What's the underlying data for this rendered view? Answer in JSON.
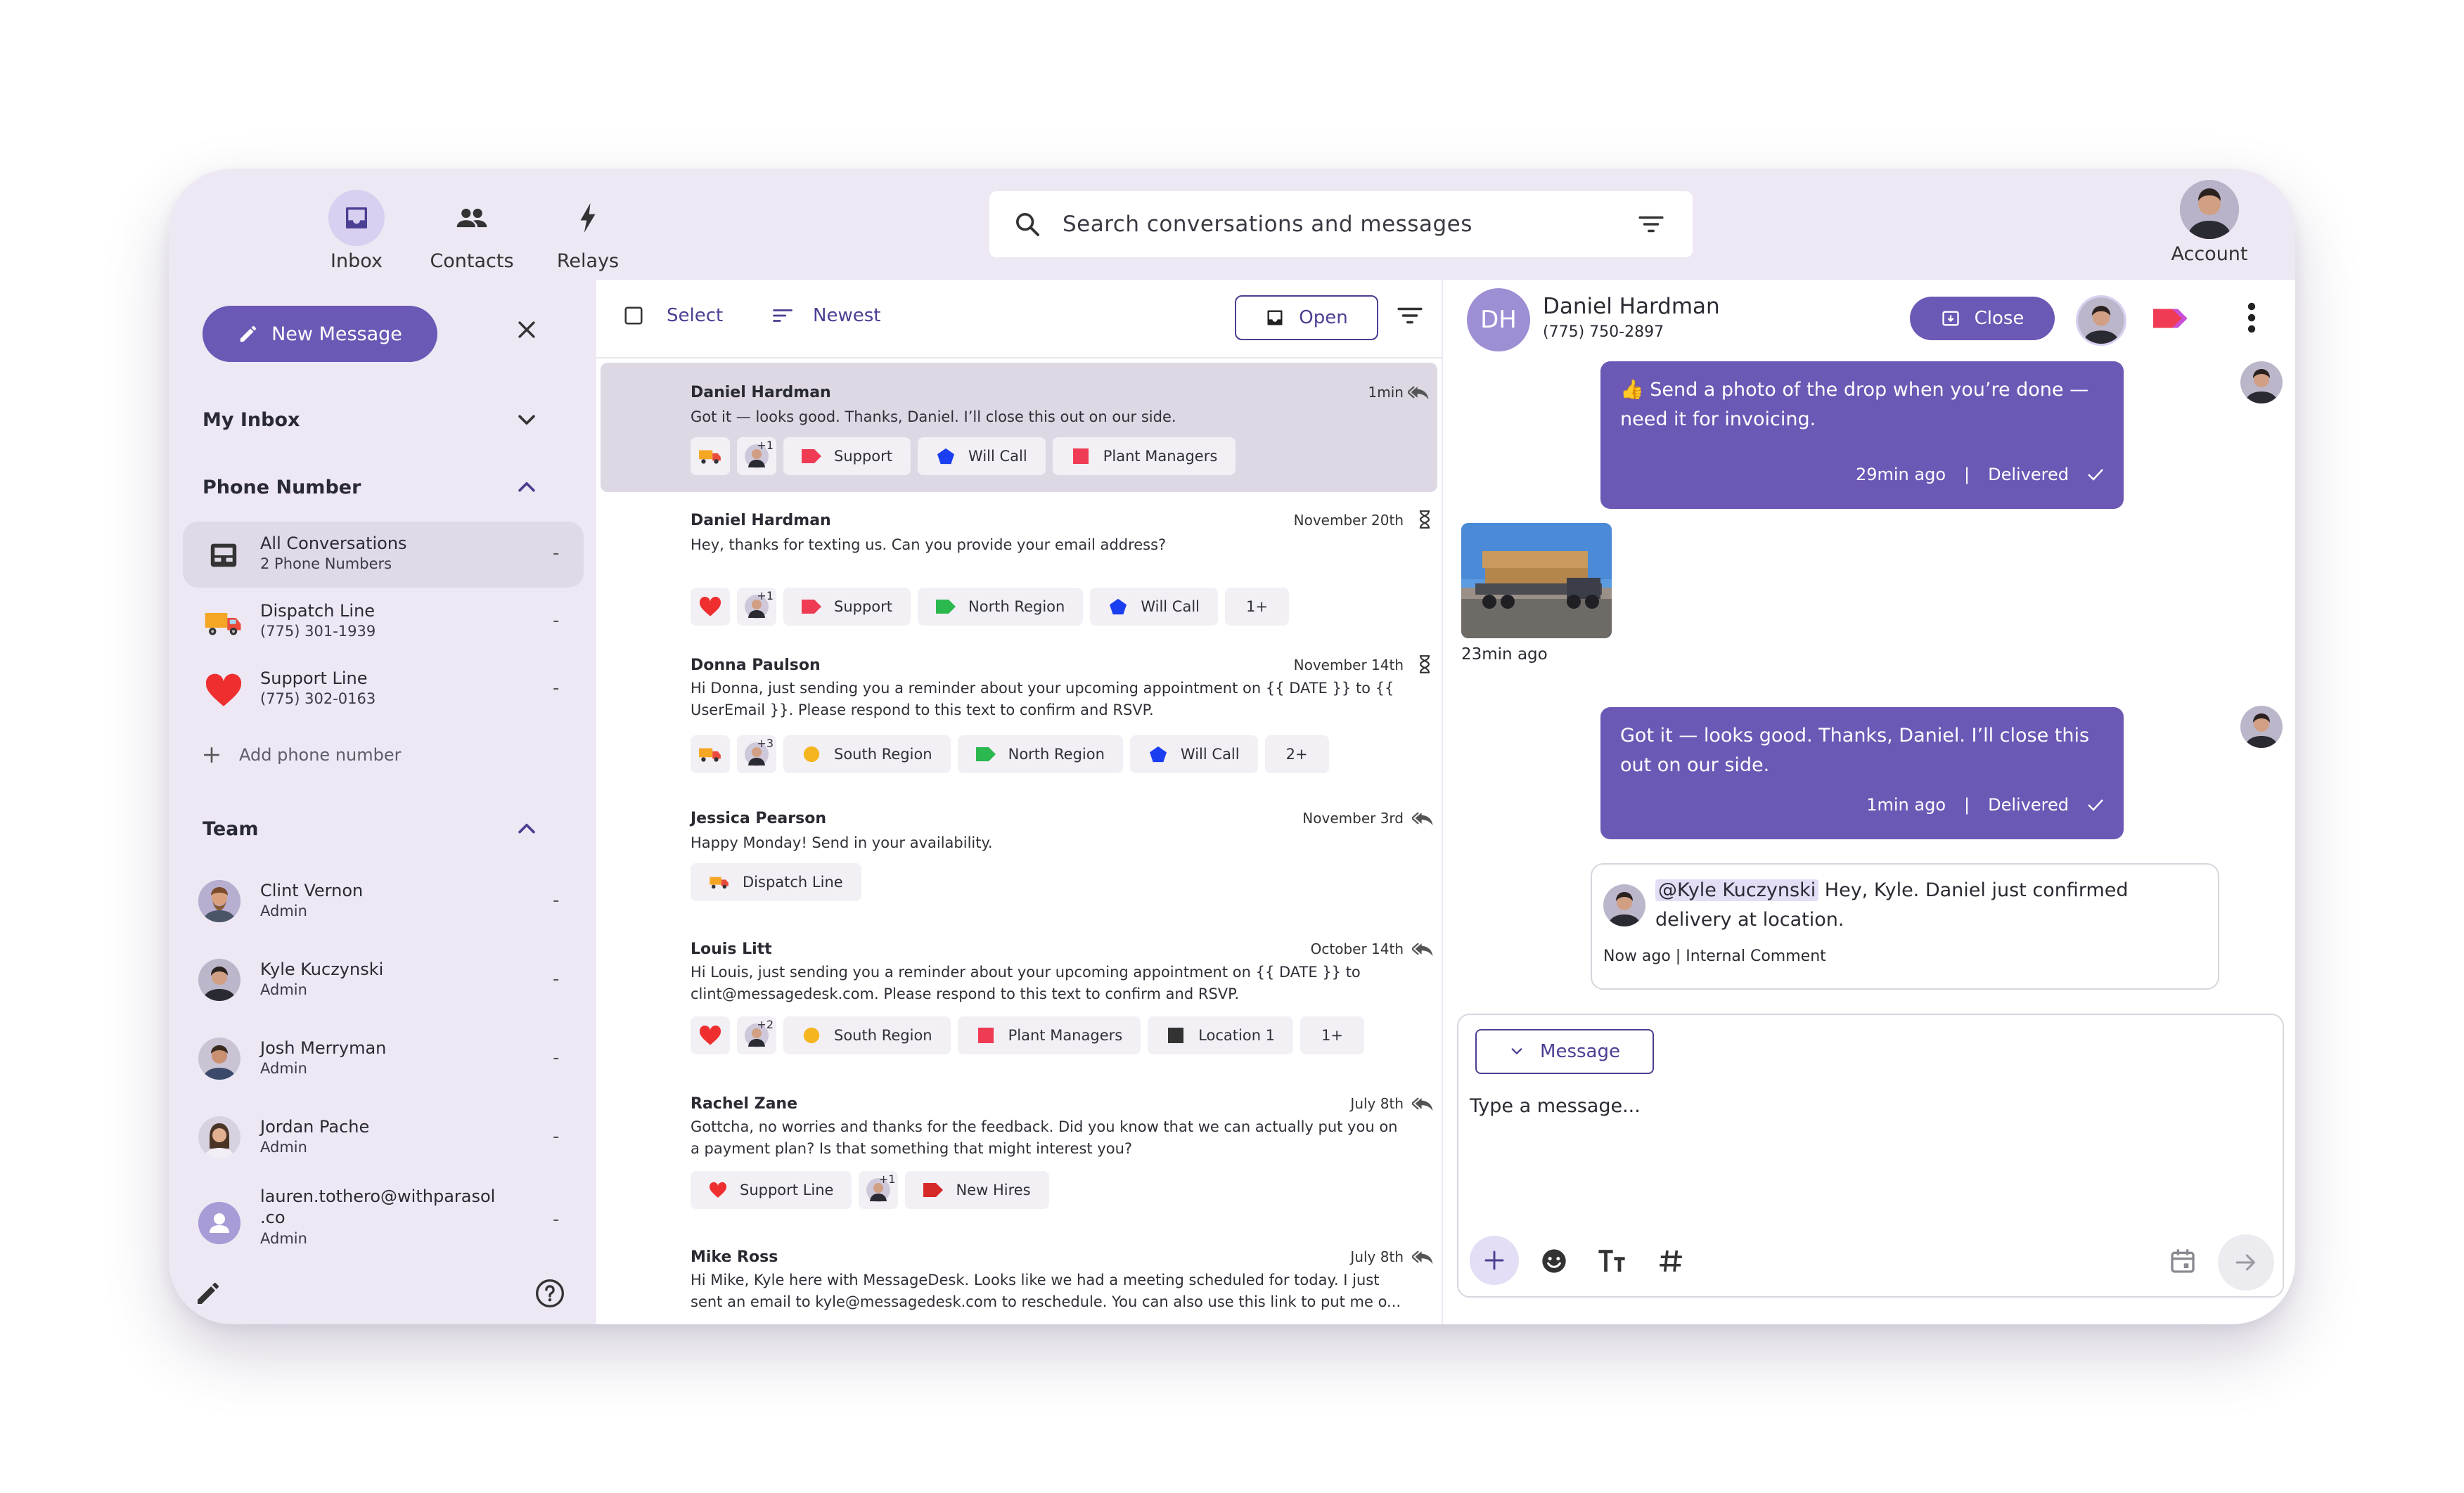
{
  "nav": {
    "inbox": "Inbox",
    "contacts": "Contacts",
    "relays": "Relays",
    "account": "Account"
  },
  "search": {
    "placeholder": "Search conversations and messages"
  },
  "sidebar": {
    "new_message": "New Message",
    "my_inbox": "My Inbox",
    "phone_number": "Phone Number",
    "phones": [
      {
        "title": "All Conversations",
        "subtitle": "2 Phone Numbers",
        "count": "-"
      },
      {
        "title": "Dispatch Line",
        "subtitle": "(775) 301-1939",
        "count": "-"
      },
      {
        "title": "Support Line",
        "subtitle": "(775) 302-0163",
        "count": "-"
      }
    ],
    "add_phone": "Add phone number",
    "team": "Team",
    "members": [
      {
        "name": "Clint Vernon",
        "role": "Admin",
        "count": "-"
      },
      {
        "name": "Kyle Kuczynski",
        "role": "Admin",
        "count": "-"
      },
      {
        "name": "Josh Merryman",
        "role": "Admin",
        "count": "-"
      },
      {
        "name": "Jordan Pache",
        "role": "Admin",
        "count": "-"
      },
      {
        "name": "lauren.tothero@withparasol",
        "name2": ".co",
        "role": "Admin",
        "count": "-"
      }
    ]
  },
  "list": {
    "select": "Select",
    "sort": "Newest",
    "status": "Open",
    "conversations": [
      {
        "name": "Daniel Hardman",
        "time": "1min",
        "preview": "Got it — looks good. Thanks, Daniel. I’ll close this out on our side.",
        "chips": [
          "+1",
          "Support",
          "Will Call",
          "Plant Managers"
        ]
      },
      {
        "name": "Daniel Hardman",
        "time": "November 20th",
        "preview": "Hey, thanks for texting us. Can you provide your email address?",
        "chips": [
          "+1",
          "Support",
          "North Region",
          "Will Call",
          "1+"
        ]
      },
      {
        "name": "Donna Paulson",
        "time": "November 14th",
        "preview": "Hi Donna, just sending you a reminder about your upcoming appointment on {{ DATE }} to {{ UserEmail }}. Please respond to this text to confirm and RSVP.",
        "chips": [
          "+3",
          "South Region",
          "North Region",
          "Will Call",
          "2+"
        ]
      },
      {
        "name": "Jessica Pearson",
        "time": "November 3rd",
        "preview": "Happy Monday! Send in your availability.",
        "chips": [
          "Dispatch Line"
        ]
      },
      {
        "name": "Louis Litt",
        "time": "October 14th",
        "preview": "Hi Louis, just sending you a reminder about your upcoming appointment on {{ DATE }} to clint@messagedesk.com. Please respond to this text to confirm and RSVP.",
        "chips": [
          "+2",
          "South Region",
          "Plant Managers",
          "Location 1",
          "1+"
        ]
      },
      {
        "name": "Rachel Zane",
        "time": "July 8th",
        "preview": "Gottcha, no worries and thanks for the feedback. Did you know that we can actually put you on a payment plan? Is that something that might interest you?",
        "chips": [
          "Support Line",
          "+1",
          "New Hires"
        ]
      },
      {
        "name": "Mike Ross",
        "time": "July 8th",
        "preview": "Hi Mike, Kyle here with MessageDesk. Looks like we had a meeting scheduled for today. I just sent an email to kyle@messagedesk.com to reschedule. You can also use this link to put me o..."
      }
    ]
  },
  "chat": {
    "initials": "DH",
    "contact_name": "Daniel Hardman",
    "contact_phone": "(775) 750-2897",
    "close": "Close",
    "messages": [
      {
        "text": "👍 Send a photo of the drop when you’re done — need it for invoicing.",
        "time": "29min ago",
        "status": "Delivered"
      },
      {
        "image_time": "23min ago"
      },
      {
        "text": "Got it — looks good. Thanks, Daniel. I’ll close this out on our side.",
        "time": "1min ago",
        "status": "Delivered"
      }
    ],
    "comment": {
      "mention": "@Kyle Kuczynski",
      "text": " Hey, Kyle. Daniel just confirmed delivery at location.",
      "meta": "Now ago | Internal Comment"
    },
    "composer": {
      "mode": "Message",
      "placeholder": "Type a message..."
    }
  },
  "colors": {
    "accent": "#6c58b5",
    "accent_dark": "#4b3f93",
    "shell": "#ede8f3",
    "support_tag": "#ef3b53",
    "will_call_tag": "#1b3ff0",
    "plant_managers_tag": "#ef3b53",
    "north_region_tag": "#2bb84f",
    "south_region_tag": "#f5b51e",
    "new_hires_tag": "#d62a2a",
    "location_tag": "#333333"
  }
}
